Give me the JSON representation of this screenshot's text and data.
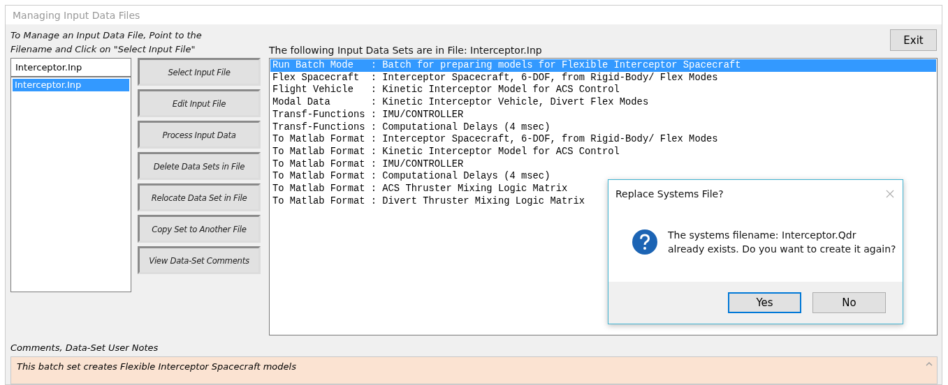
{
  "window": {
    "title": "Managing Input Data Files"
  },
  "instructions": "To Manage an Input Data File, Point to the Filename and Click on \"Select Input File\"",
  "exit_button": "Exit",
  "file_field": {
    "value": "Interceptor.Inp"
  },
  "files": [
    {
      "name": "Interceptor.Inp",
      "selected": true
    }
  ],
  "actions": [
    "Select Input File",
    "Edit Input File",
    "Process Input Data",
    "Delete Data Sets in File",
    "Relocate Data Set in File",
    "Copy Set to Another File",
    "View Data-Set Comments"
  ],
  "data_sets_heading": "The following Input Data Sets are in File: Interceptor.Inp",
  "data_sets": [
    {
      "text": "Run Batch Mode   : Batch for preparing models for Flexible Interceptor Spacecraft",
      "selected": true
    },
    {
      "text": "Flex Spacecraft  : Interceptor Spacecraft, 6-DOF, from Rigid-Body/ Flex Modes",
      "selected": false
    },
    {
      "text": "Flight Vehicle   : Kinetic Interceptor Model for ACS Control",
      "selected": false
    },
    {
      "text": "Modal Data       : Kinetic Interceptor Vehicle, Divert Flex Modes",
      "selected": false
    },
    {
      "text": "Transf-Functions : IMU/CONTROLLER",
      "selected": false
    },
    {
      "text": "Transf-Functions : Computational Delays (4 msec)",
      "selected": false
    },
    {
      "text": "To Matlab Format : Interceptor Spacecraft, 6-DOF, from Rigid-Body/ Flex Modes",
      "selected": false
    },
    {
      "text": "To Matlab Format : Kinetic Interceptor Model for ACS Control",
      "selected": false
    },
    {
      "text": "To Matlab Format : IMU/CONTROLLER",
      "selected": false
    },
    {
      "text": "To Matlab Format : Computational Delays (4 msec)",
      "selected": false
    },
    {
      "text": "To Matlab Format : ACS Thruster Mixing Logic Matrix",
      "selected": false
    },
    {
      "text": "To Matlab Format : Divert Thruster Mixing Logic Matrix",
      "selected": false
    }
  ],
  "comments": {
    "label": "Comments, Data-Set User Notes",
    "text": "This batch set creates Flexible Interceptor Spacecraft models"
  },
  "dialog": {
    "title": "Replace Systems File?",
    "message": "The systems filename: Interceptor.Qdr\nalready exists. Do you want to create it again?",
    "buttons": [
      {
        "label": "Yes",
        "selected": true
      },
      {
        "label": "No",
        "selected": false
      }
    ]
  }
}
